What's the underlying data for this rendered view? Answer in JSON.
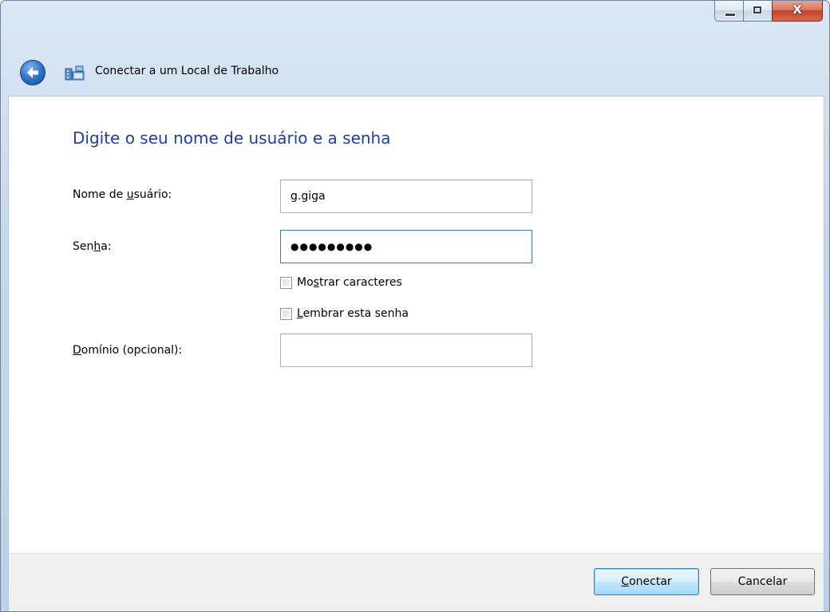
{
  "window": {
    "title": "Conectar a um Local de Trabalho",
    "caption_buttons": {
      "minimize_icon": "minimize-icon",
      "maximize_icon": "maximize-icon",
      "close_glyph": "X"
    }
  },
  "form": {
    "heading": "Digite o seu nome de usuário e a senha",
    "username": {
      "label_pre": "Nome de ",
      "label_key": "u",
      "label_post": "suário:",
      "value": "g.giga"
    },
    "password": {
      "label_pre": "Sen",
      "label_key": "h",
      "label_post": "a:",
      "value_masked": "●●●●●●●●●"
    },
    "show_chars": {
      "label_pre": "Mo",
      "label_key": "s",
      "label_post": "trar caracteres",
      "checked": false
    },
    "remember": {
      "label_pre": "",
      "label_key": "L",
      "label_post": "embrar esta senha",
      "checked": false
    },
    "domain": {
      "label_pre": "",
      "label_key": "D",
      "label_post": "omínio (opcional):",
      "value": ""
    }
  },
  "footer": {
    "connect": {
      "label_pre": "",
      "label_key": "C",
      "label_post": "onectar"
    },
    "cancel": {
      "label": "Cancelar"
    }
  },
  "colors": {
    "heading": "#1e3ea5",
    "accent": "#2c6fc0"
  }
}
